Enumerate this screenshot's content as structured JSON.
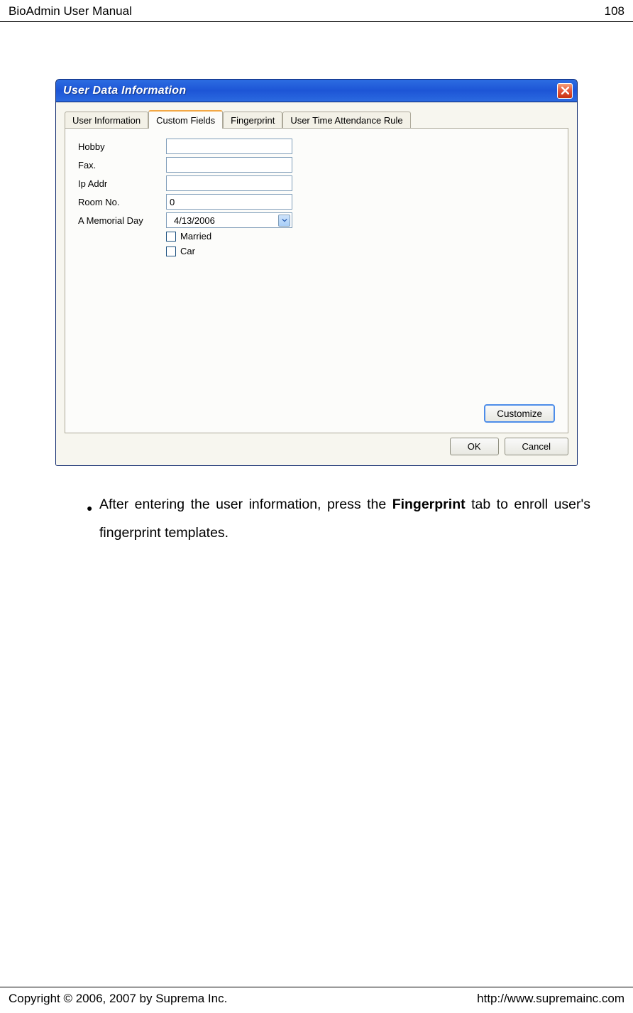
{
  "header": {
    "doc_title": "BioAdmin User Manual",
    "page_number": "108"
  },
  "footer": {
    "copyright": "Copyright © 2006, 2007 by Suprema Inc.",
    "url": "http://www.supremainc.com"
  },
  "dialog": {
    "title": "User Data Information",
    "close_icon": "close-icon",
    "tabs": {
      "user_information": "User Information",
      "custom_fields": "Custom Fields",
      "fingerprint": "Fingerprint",
      "user_time_attendance_rule": "User Time Attendance Rule"
    },
    "fields": {
      "hobby_label": "Hobby",
      "hobby_value": "",
      "fax_label": "Fax.",
      "fax_value": "",
      "ip_addr_label": "Ip Addr",
      "ip_addr_value": "",
      "room_no_label": "Room No.",
      "room_no_value": "0",
      "memorial_day_label": "A Memorial Day",
      "memorial_day_value": "4/13/2006",
      "married_label": "Married",
      "car_label": "Car"
    },
    "buttons": {
      "customize": "Customize",
      "ok": "OK",
      "cancel": "Cancel"
    }
  },
  "paragraph": {
    "text_before_bold": "After entering the user information, press the ",
    "bold_word": "Fingerprint",
    "text_after_bold": " tab to enroll user's fingerprint templates."
  }
}
